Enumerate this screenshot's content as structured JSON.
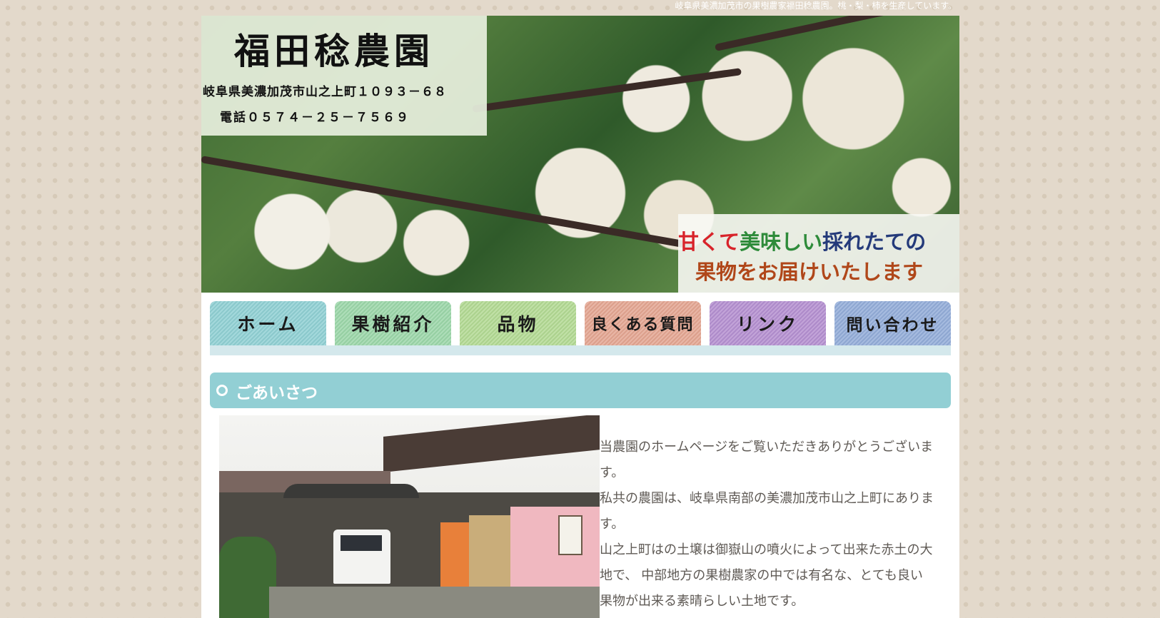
{
  "site": {
    "tagline": "岐阜県美濃加茂市の果樹農家福田稔農園。桃・梨・柿を生産しています。"
  },
  "header": {
    "farm_name": "福田稔農園",
    "address": "岐阜県美濃加茂市山之上町１０９３－６８",
    "phone": "電話０５７４－２５－７５６９",
    "slogan": {
      "line1": [
        {
          "text": "甘くて",
          "color": "#d8232a"
        },
        {
          "text": "美味しい",
          "color": "#2e8b3a"
        },
        {
          "text": "採れたての",
          "color": "#243a7a"
        }
      ],
      "line2": [
        {
          "text": "果物をお届けいたします",
          "color": "#b0471a"
        }
      ]
    }
  },
  "nav": {
    "items": [
      {
        "label": "ホーム",
        "color": "#8fcfd3"
      },
      {
        "label": "果樹紹介",
        "color": "#9bd6a8"
      },
      {
        "label": "品物",
        "color": "#b2d993"
      },
      {
        "label": "良くある質問",
        "color": "#e3a591"
      },
      {
        "label": "リンク",
        "color": "#b48fd0"
      },
      {
        "label": "問い合わせ",
        "color": "#93acd8"
      }
    ]
  },
  "section": {
    "title": "ごあいさつ",
    "photo_alt": "農園の作業場の写真",
    "paragraphs": [
      "当農園のホームページをご覧いただきありがとうございます。",
      "私共の農園は、岐阜県南部の美濃加茂市山之上町にあります。",
      "山之上町はの土壌は御嶽山の噴火によって出来た赤土の大地で、 中部地方の果樹農家の中では有名な、とても良い果物が出来る素晴らしい土地です。"
    ]
  }
}
